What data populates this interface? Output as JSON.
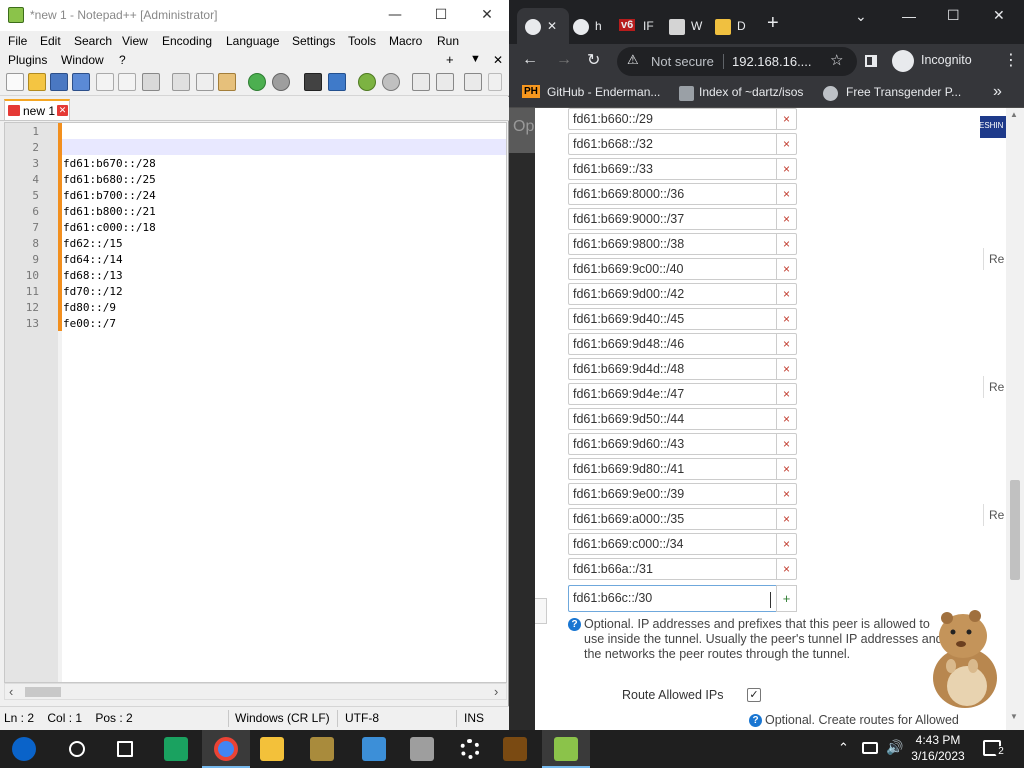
{
  "notepad": {
    "title": "*new 1 - Notepad++ [Administrator]",
    "menu_row1": [
      "File",
      "Edit",
      "Search",
      "View",
      "Encoding",
      "Language",
      "Settings",
      "Tools",
      "Macro",
      "Run"
    ],
    "menu_row2": [
      "Plugins",
      "Window",
      "?"
    ],
    "menu_right": {
      "plus": "+",
      "down": "▼",
      "close": "✕"
    },
    "tab_label": "new 1",
    "tab_close": "✕",
    "lines": [
      {
        "n": "1",
        "t": ""
      },
      {
        "n": "2",
        "t": ""
      },
      {
        "n": "3",
        "t": "fd61:b670::/28"
      },
      {
        "n": "4",
        "t": "fd61:b680::/25"
      },
      {
        "n": "5",
        "t": "fd61:b700::/24"
      },
      {
        "n": "6",
        "t": "fd61:b800::/21"
      },
      {
        "n": "7",
        "t": "fd61:c000::/18"
      },
      {
        "n": "8",
        "t": "fd62::/15"
      },
      {
        "n": "9",
        "t": "fd64::/14"
      },
      {
        "n": "10",
        "t": "fd68::/13"
      },
      {
        "n": "11",
        "t": "fd70::/12"
      },
      {
        "n": "12",
        "t": "fd80::/9"
      },
      {
        "n": "13",
        "t": "fe00::/7"
      }
    ],
    "scroll_left": "‹",
    "scroll_right": "›",
    "status": {
      "position": "Ln : 2    Col : 1    Pos : 2",
      "eol": "Windows (CR LF)",
      "encoding": "UTF-8",
      "mode": "INS"
    }
  },
  "chrome": {
    "tabs": [
      {
        "text": "",
        "close": "✕"
      },
      {
        "text": "h"
      },
      {
        "text": "IF",
        "badge": "v6"
      },
      {
        "text": "W"
      },
      {
        "text": "D"
      }
    ],
    "new_tab": "+",
    "tab_menu": "⌄",
    "address": {
      "security": "Not secure",
      "url": "192.168.16...."
    },
    "profile": "Incognito",
    "bookmarks": [
      {
        "icon": "PH",
        "text": "GitHub - Enderman..."
      },
      {
        "text": "Index of ~dartz/isos"
      },
      {
        "text": "Free Transgender P..."
      }
    ],
    "bookmarks_more": "»",
    "page_peek": {
      "top_left": "Op",
      "top_right": "ESHIN",
      "side_buttons": [
        "Re",
        "Re",
        "Re"
      ]
    },
    "allowed_ips": [
      "fd61:b660::/29",
      "fd61:b668::/32",
      "fd61:b669::/33",
      "fd61:b669:8000::/36",
      "fd61:b669:9000::/37",
      "fd61:b669:9800::/38",
      "fd61:b669:9c00::/40",
      "fd61:b669:9d00::/42",
      "fd61:b669:9d40::/45",
      "fd61:b669:9d48::/46",
      "fd61:b669:9d4d::/48",
      "fd61:b669:9d4e::/47",
      "fd61:b669:9d50::/44",
      "fd61:b669:9d60::/43",
      "fd61:b669:9d80::/41",
      "fd61:b669:9e00::/39",
      "fd61:b669:a000::/35",
      "fd61:b669:c000::/34",
      "fd61:b66a::/31"
    ],
    "delete_symbol": "×",
    "new_ip_value": "fd61:b66c::/30",
    "add_symbol": "+",
    "help_symbol": "?",
    "help_allowed_ips": [
      "Optional. IP addresses and prefixes that this peer is allowed to",
      "use inside the tunnel. Usually the peer's tunnel IP addresses and",
      "the networks the peer routes through the tunnel."
    ],
    "route_allowed_label": "Route Allowed IPs",
    "route_allowed_checked": "✓",
    "help_route": "Optional. Create routes for Allowed"
  },
  "taskbar": {
    "clock_time": "4:43 PM",
    "clock_date": "3/16/2023",
    "notification_count": "2",
    "tray_more": "⌃"
  }
}
